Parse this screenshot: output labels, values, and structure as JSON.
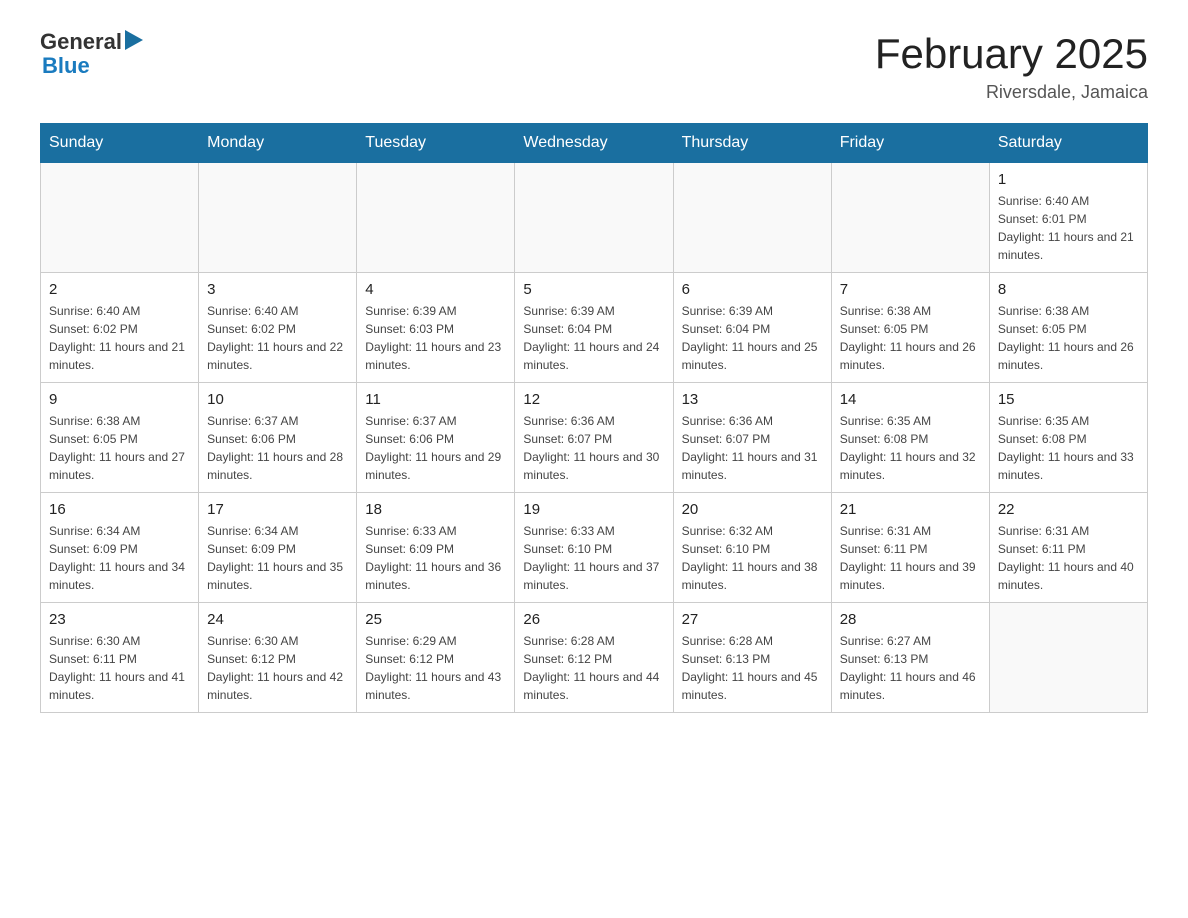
{
  "header": {
    "logo_general": "General",
    "logo_blue": "Blue",
    "title": "February 2025",
    "location": "Riversdale, Jamaica"
  },
  "days_of_week": [
    "Sunday",
    "Monday",
    "Tuesday",
    "Wednesday",
    "Thursday",
    "Friday",
    "Saturday"
  ],
  "weeks": [
    [
      {
        "day": "",
        "sunrise": "",
        "sunset": "",
        "daylight": ""
      },
      {
        "day": "",
        "sunrise": "",
        "sunset": "",
        "daylight": ""
      },
      {
        "day": "",
        "sunrise": "",
        "sunset": "",
        "daylight": ""
      },
      {
        "day": "",
        "sunrise": "",
        "sunset": "",
        "daylight": ""
      },
      {
        "day": "",
        "sunrise": "",
        "sunset": "",
        "daylight": ""
      },
      {
        "day": "",
        "sunrise": "",
        "sunset": "",
        "daylight": ""
      },
      {
        "day": "1",
        "sunrise": "Sunrise: 6:40 AM",
        "sunset": "Sunset: 6:01 PM",
        "daylight": "Daylight: 11 hours and 21 minutes."
      }
    ],
    [
      {
        "day": "2",
        "sunrise": "Sunrise: 6:40 AM",
        "sunset": "Sunset: 6:02 PM",
        "daylight": "Daylight: 11 hours and 21 minutes."
      },
      {
        "day": "3",
        "sunrise": "Sunrise: 6:40 AM",
        "sunset": "Sunset: 6:02 PM",
        "daylight": "Daylight: 11 hours and 22 minutes."
      },
      {
        "day": "4",
        "sunrise": "Sunrise: 6:39 AM",
        "sunset": "Sunset: 6:03 PM",
        "daylight": "Daylight: 11 hours and 23 minutes."
      },
      {
        "day": "5",
        "sunrise": "Sunrise: 6:39 AM",
        "sunset": "Sunset: 6:04 PM",
        "daylight": "Daylight: 11 hours and 24 minutes."
      },
      {
        "day": "6",
        "sunrise": "Sunrise: 6:39 AM",
        "sunset": "Sunset: 6:04 PM",
        "daylight": "Daylight: 11 hours and 25 minutes."
      },
      {
        "day": "7",
        "sunrise": "Sunrise: 6:38 AM",
        "sunset": "Sunset: 6:05 PM",
        "daylight": "Daylight: 11 hours and 26 minutes."
      },
      {
        "day": "8",
        "sunrise": "Sunrise: 6:38 AM",
        "sunset": "Sunset: 6:05 PM",
        "daylight": "Daylight: 11 hours and 26 minutes."
      }
    ],
    [
      {
        "day": "9",
        "sunrise": "Sunrise: 6:38 AM",
        "sunset": "Sunset: 6:05 PM",
        "daylight": "Daylight: 11 hours and 27 minutes."
      },
      {
        "day": "10",
        "sunrise": "Sunrise: 6:37 AM",
        "sunset": "Sunset: 6:06 PM",
        "daylight": "Daylight: 11 hours and 28 minutes."
      },
      {
        "day": "11",
        "sunrise": "Sunrise: 6:37 AM",
        "sunset": "Sunset: 6:06 PM",
        "daylight": "Daylight: 11 hours and 29 minutes."
      },
      {
        "day": "12",
        "sunrise": "Sunrise: 6:36 AM",
        "sunset": "Sunset: 6:07 PM",
        "daylight": "Daylight: 11 hours and 30 minutes."
      },
      {
        "day": "13",
        "sunrise": "Sunrise: 6:36 AM",
        "sunset": "Sunset: 6:07 PM",
        "daylight": "Daylight: 11 hours and 31 minutes."
      },
      {
        "day": "14",
        "sunrise": "Sunrise: 6:35 AM",
        "sunset": "Sunset: 6:08 PM",
        "daylight": "Daylight: 11 hours and 32 minutes."
      },
      {
        "day": "15",
        "sunrise": "Sunrise: 6:35 AM",
        "sunset": "Sunset: 6:08 PM",
        "daylight": "Daylight: 11 hours and 33 minutes."
      }
    ],
    [
      {
        "day": "16",
        "sunrise": "Sunrise: 6:34 AM",
        "sunset": "Sunset: 6:09 PM",
        "daylight": "Daylight: 11 hours and 34 minutes."
      },
      {
        "day": "17",
        "sunrise": "Sunrise: 6:34 AM",
        "sunset": "Sunset: 6:09 PM",
        "daylight": "Daylight: 11 hours and 35 minutes."
      },
      {
        "day": "18",
        "sunrise": "Sunrise: 6:33 AM",
        "sunset": "Sunset: 6:09 PM",
        "daylight": "Daylight: 11 hours and 36 minutes."
      },
      {
        "day": "19",
        "sunrise": "Sunrise: 6:33 AM",
        "sunset": "Sunset: 6:10 PM",
        "daylight": "Daylight: 11 hours and 37 minutes."
      },
      {
        "day": "20",
        "sunrise": "Sunrise: 6:32 AM",
        "sunset": "Sunset: 6:10 PM",
        "daylight": "Daylight: 11 hours and 38 minutes."
      },
      {
        "day": "21",
        "sunrise": "Sunrise: 6:31 AM",
        "sunset": "Sunset: 6:11 PM",
        "daylight": "Daylight: 11 hours and 39 minutes."
      },
      {
        "day": "22",
        "sunrise": "Sunrise: 6:31 AM",
        "sunset": "Sunset: 6:11 PM",
        "daylight": "Daylight: 11 hours and 40 minutes."
      }
    ],
    [
      {
        "day": "23",
        "sunrise": "Sunrise: 6:30 AM",
        "sunset": "Sunset: 6:11 PM",
        "daylight": "Daylight: 11 hours and 41 minutes."
      },
      {
        "day": "24",
        "sunrise": "Sunrise: 6:30 AM",
        "sunset": "Sunset: 6:12 PM",
        "daylight": "Daylight: 11 hours and 42 minutes."
      },
      {
        "day": "25",
        "sunrise": "Sunrise: 6:29 AM",
        "sunset": "Sunset: 6:12 PM",
        "daylight": "Daylight: 11 hours and 43 minutes."
      },
      {
        "day": "26",
        "sunrise": "Sunrise: 6:28 AM",
        "sunset": "Sunset: 6:12 PM",
        "daylight": "Daylight: 11 hours and 44 minutes."
      },
      {
        "day": "27",
        "sunrise": "Sunrise: 6:28 AM",
        "sunset": "Sunset: 6:13 PM",
        "daylight": "Daylight: 11 hours and 45 minutes."
      },
      {
        "day": "28",
        "sunrise": "Sunrise: 6:27 AM",
        "sunset": "Sunset: 6:13 PM",
        "daylight": "Daylight: 11 hours and 46 minutes."
      },
      {
        "day": "",
        "sunrise": "",
        "sunset": "",
        "daylight": ""
      }
    ]
  ]
}
